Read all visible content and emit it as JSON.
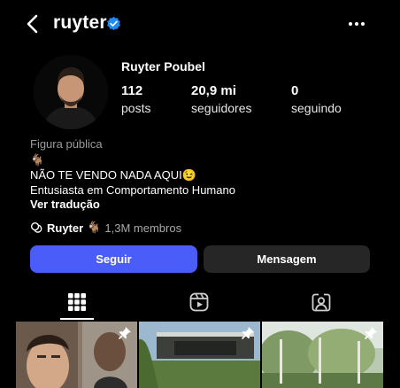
{
  "header": {
    "username": "ruyter"
  },
  "profile": {
    "full_name": "Ruyter Poubel",
    "stats": [
      {
        "value": "112",
        "label": "posts"
      },
      {
        "value": "20,9 mi",
        "label": "seguidores"
      },
      {
        "value": "0",
        "label": "seguindo"
      }
    ],
    "category": "Figura pública",
    "bio": [
      "🐐",
      "NÃO TE VENDO NADA AQUI😉",
      "Entusiasta em Comportamento Humano"
    ],
    "see_translation": "Ver tradução",
    "community": {
      "name": "Ruyter",
      "emoji": "🐐",
      "members": "1,3M membros"
    }
  },
  "actions": {
    "follow_label": "Seguir",
    "message_label": "Mensagem"
  },
  "tabs": [
    {
      "icon": "grid-icon",
      "active": true
    },
    {
      "icon": "reels-icon",
      "active": false
    },
    {
      "icon": "tagged-icon",
      "active": false
    }
  ],
  "colors": {
    "background": "#000000",
    "follow_button": "#4a5df9",
    "message_button": "#262626",
    "verified": "#1d8cf8",
    "secondary_text": "#9a9a9a"
  }
}
